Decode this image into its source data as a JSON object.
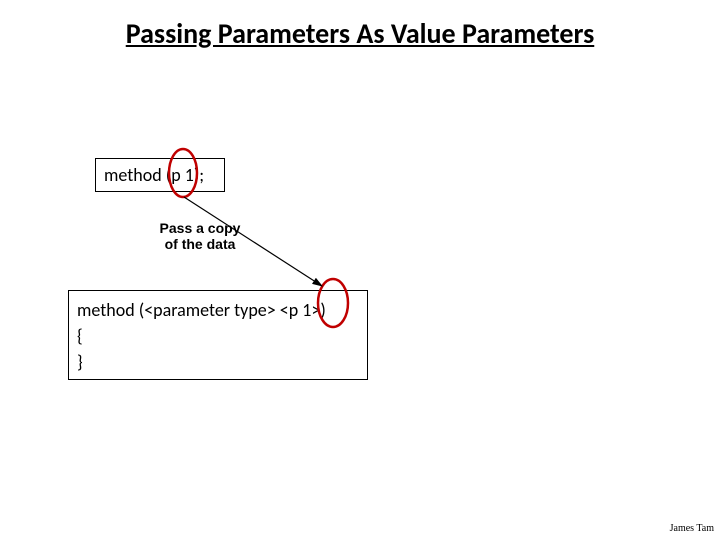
{
  "title": "Passing Parameters As Value Parameters",
  "call_box": "method (p 1);",
  "annotation_line1": "Pass a copy",
  "annotation_line2": "of the data",
  "def_line1": "method (<parameter type> <p 1>)",
  "def_line2": "{",
  "def_line3": "}",
  "footer": "James Tam",
  "colors": {
    "ellipse_stroke": "#c00000",
    "arrow_stroke": "#000000"
  }
}
